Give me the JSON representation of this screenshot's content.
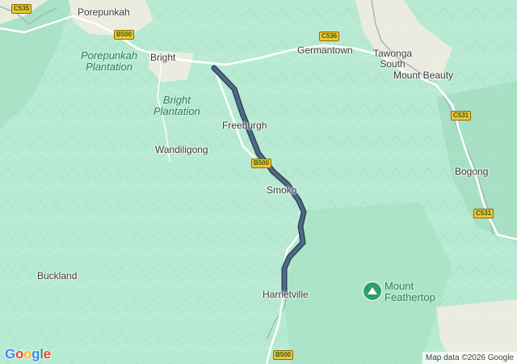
{
  "colors": {
    "terrain": "#b8ead3",
    "route": "#4f6a87",
    "route_edge": "#31445a",
    "road": "#ffffff",
    "river": "#9bb9c7",
    "park_text": "#2f7f59",
    "peak_icon": "#2f9f6a",
    "shield_fill": "#f4c430"
  },
  "places": {
    "porepunkah": "Porepunkah",
    "bright": "Bright",
    "germantown": "Germantown",
    "tawonga_south": "Tawonga\nSouth",
    "mount_beauty": "Mount Beauty",
    "freeburgh": "Freeburgh",
    "wandiligong": "Wandiligong",
    "bogong": "Bogong",
    "smoko": "Smoko",
    "buckland": "Buckland",
    "harrietville": "Harrietville"
  },
  "parks": {
    "porepunkah_plantation": "Porepunkah\nPlantation",
    "bright_plantation": "Bright\nPlantation"
  },
  "peak": {
    "name": "Mount\nFeathertop",
    "icon": "mountain-icon"
  },
  "shields": {
    "c535": "C535",
    "b500_top": "B500",
    "c536": "C536",
    "c531_right": "C531",
    "b500_mid": "B500",
    "c531_lower": "C531",
    "b500_bottom": "B500"
  },
  "branding": {
    "logo": "Google",
    "attribution": "Map data ©2026 Google"
  }
}
